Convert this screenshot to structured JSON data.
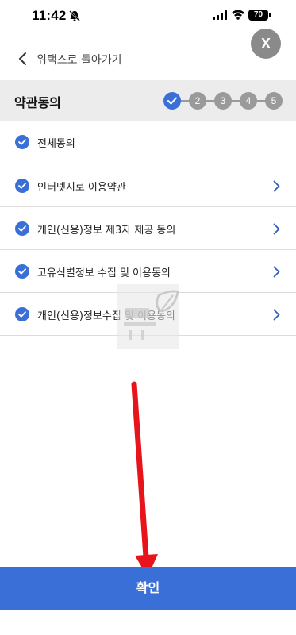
{
  "status_bar": {
    "time": "11:42",
    "battery": "70"
  },
  "close_label": "X",
  "nav": {
    "back_label": "위택스로 돌아가기"
  },
  "section": {
    "title": "약관동의",
    "steps": [
      "2",
      "3",
      "4",
      "5"
    ]
  },
  "agreements": [
    {
      "label": "전체동의",
      "checked": true,
      "has_detail": false
    },
    {
      "label": "인터넷지로 이용약관",
      "checked": true,
      "has_detail": true
    },
    {
      "label": "개인(신용)정보 제3자 제공 동의",
      "checked": true,
      "has_detail": true
    },
    {
      "label": "고유식별정보 수집 및 이용동의",
      "checked": true,
      "has_detail": true
    },
    {
      "label": "개인(신용)정보수집 및 이용동의",
      "checked": true,
      "has_detail": true
    }
  ],
  "confirm_label": "확인",
  "colors": {
    "accent": "#3b6fd8",
    "inactive": "#9a9a9a",
    "header_bg": "#ececec",
    "annotation_arrow": "#e8141c"
  }
}
